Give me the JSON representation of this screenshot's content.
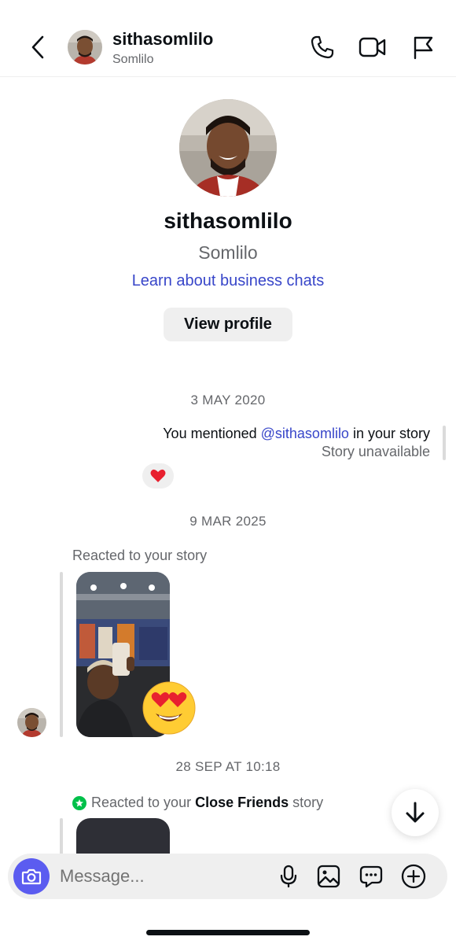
{
  "header": {
    "name": "sithasomlilo",
    "subtitle": "Somlilo"
  },
  "profile": {
    "name": "sithasomlilo",
    "subtitle": "Somlilo",
    "link": "Learn about business chats",
    "button": "View profile"
  },
  "thread": {
    "date1": "3 MAY 2020",
    "mention_prefix": "You mentioned ",
    "mention_handle": "@sithasomlilo",
    "mention_suffix": " in your story",
    "mention_status": "Story unavailable",
    "date2": "9 MAR 2025",
    "reacted_label": "Reacted to your story",
    "date3": "28 SEP AT 10:18",
    "cf_prefix": "Reacted to your ",
    "cf_bold": "Close Friends",
    "cf_suffix": " story"
  },
  "composer": {
    "placeholder": "Message..."
  },
  "colors": {
    "link": "#3846c9",
    "camera_button": "#5b5cf0",
    "close_friends": "#00c04a",
    "muted_text": "#65676b"
  }
}
